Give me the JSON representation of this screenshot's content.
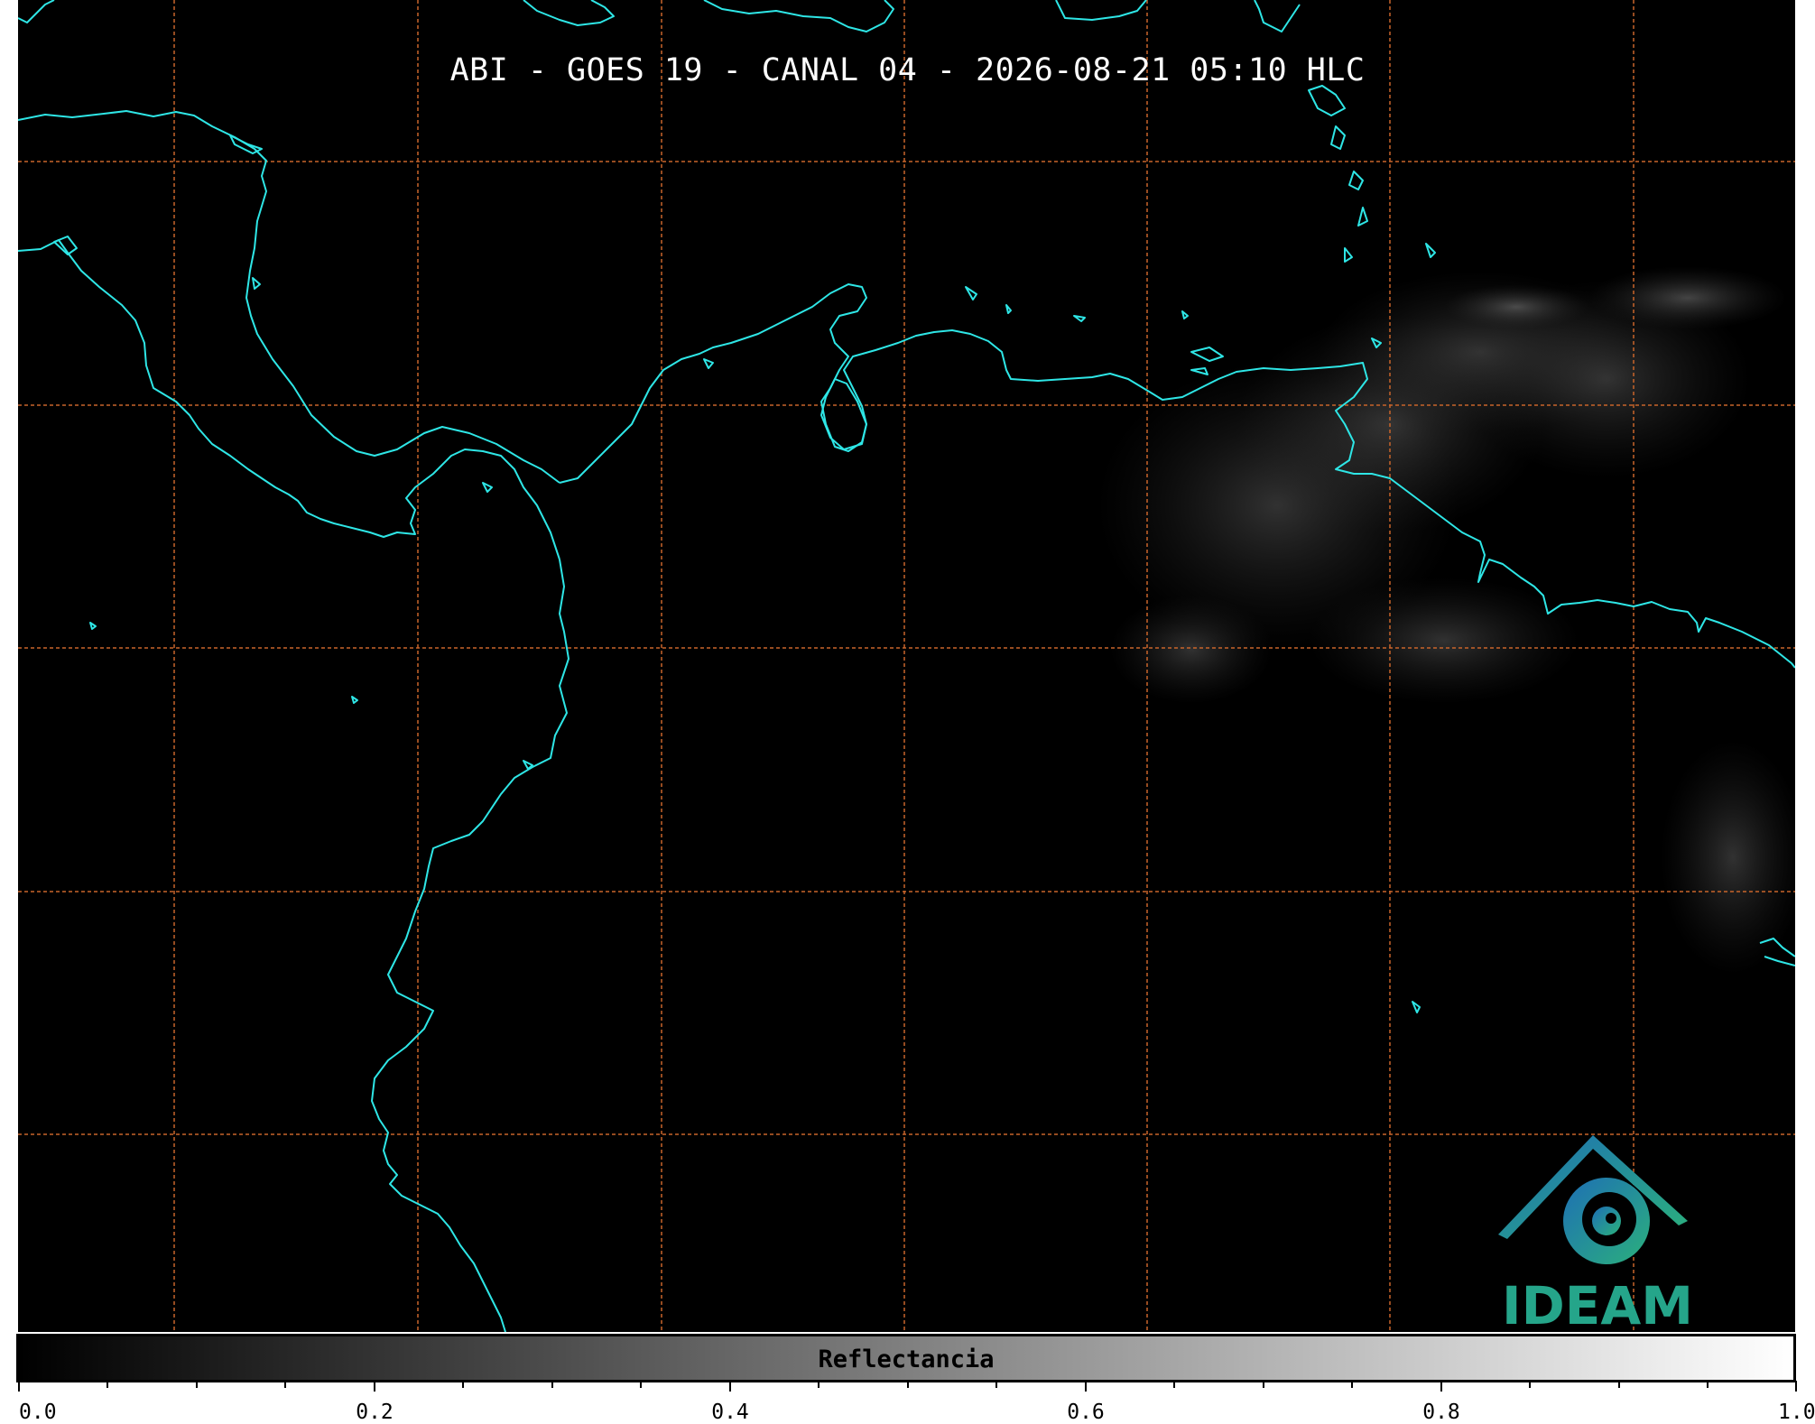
{
  "title": "ABI - GOES 19 - CANAL 04 - 2026-08-21 05:10 HLC",
  "colors": {
    "coastline": "#2ee6e6",
    "gridline": "#c8642a",
    "background": "#000000"
  },
  "colorbar": {
    "label": "Reflectancia",
    "min": 0.0,
    "max": 1.0,
    "tick_labels": [
      "0.0",
      "0.2",
      "0.4",
      "0.6",
      "0.8",
      "1.0"
    ]
  },
  "logo": {
    "text": "IDEAM"
  }
}
